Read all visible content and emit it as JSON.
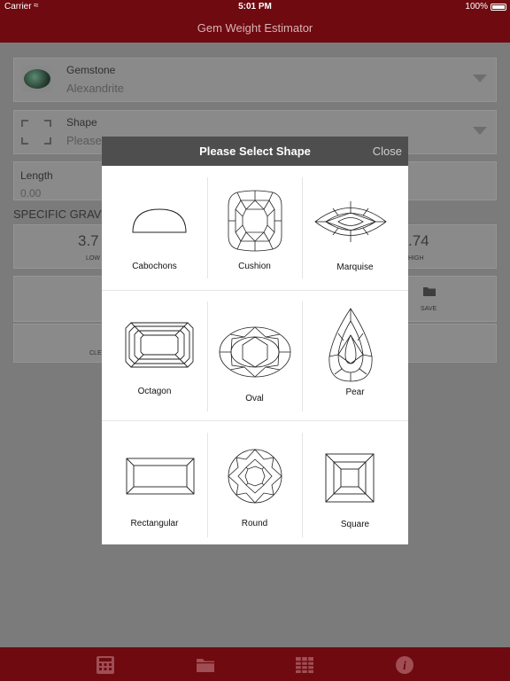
{
  "status": {
    "carrier": "Carrier",
    "time": "5:01 PM",
    "battery": "100%"
  },
  "nav": {
    "title": "Gem Weight Estimator"
  },
  "form": {
    "gemstone_label": "Gemstone",
    "gemstone_value": "Alexandrite",
    "shape_label": "Shape",
    "shape_value": "Please S",
    "length_label": "Length",
    "length_value": "0.00",
    "specific_gravity_title": "SPECIFIC GRAV",
    "sg_low_value": "3.7",
    "sg_low_label": "LOW",
    "sg_high_value": ".74",
    "sg_high_label": "HIGH",
    "save_label": "SAVE",
    "clear_label": "CLE"
  },
  "modal": {
    "title": "Please Select Shape",
    "close_label": "Close",
    "shapes": [
      "Cabochons",
      "Cushion",
      "Marquise",
      "Octagon",
      "Oval",
      "Pear",
      "Rectangular",
      "Round",
      "Square"
    ]
  },
  "tabbar": {
    "icons": [
      "calculator-icon",
      "folder-icon",
      "table-icon",
      "info-icon"
    ]
  }
}
